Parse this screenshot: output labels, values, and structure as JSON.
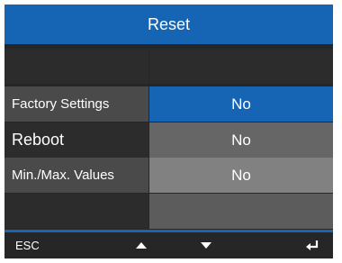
{
  "title": "Reset",
  "rows": [
    {
      "label": "Factory Settings",
      "value": "No"
    },
    {
      "label": "Reboot",
      "value": "No"
    },
    {
      "label": "Min./Max. Values",
      "value": "No"
    }
  ],
  "softkeys": {
    "esc_label": "ESC",
    "up_icon": "up-arrow-icon",
    "down_icon": "down-arrow-icon",
    "enter_icon": "enter-icon"
  },
  "colors": {
    "accent": "#1565b4",
    "background": "#262626"
  }
}
